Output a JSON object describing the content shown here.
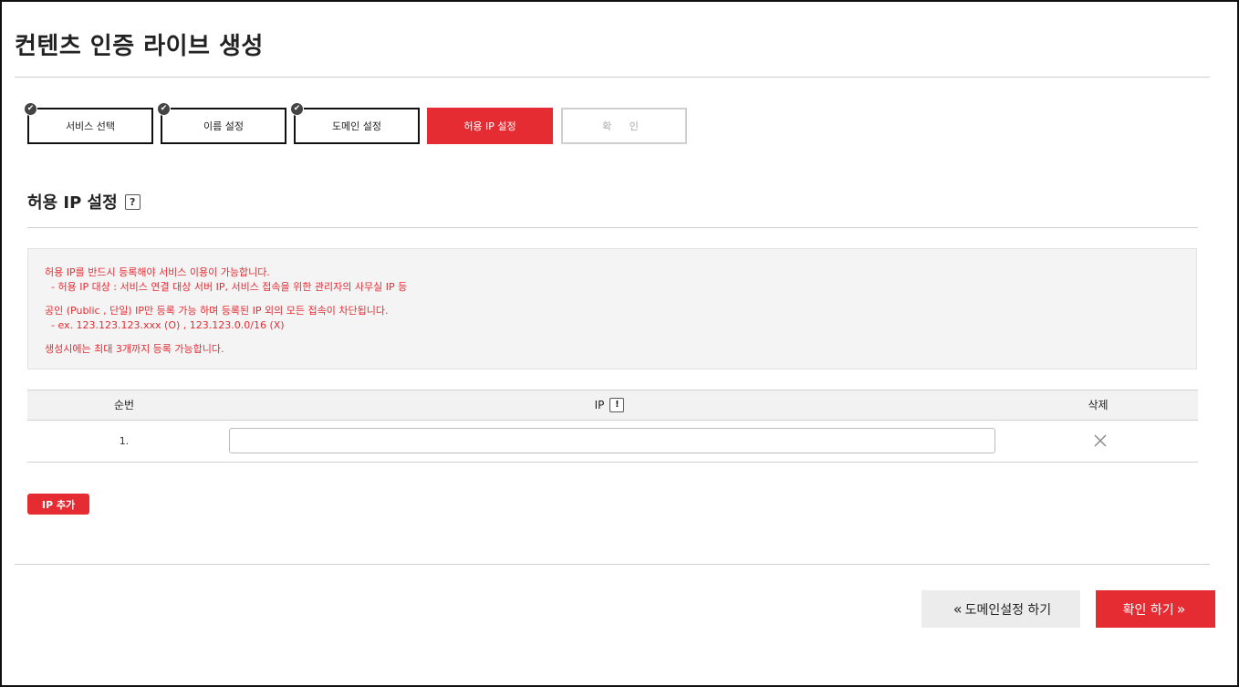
{
  "page": {
    "title": "컨텐츠 인증 라이브 생성"
  },
  "steps": [
    {
      "label": "서비스 선택",
      "status": "done"
    },
    {
      "label": "이름 설정",
      "status": "done"
    },
    {
      "label": "도메인 설정",
      "status": "done"
    },
    {
      "label": "허용 IP 설정",
      "status": "active"
    },
    {
      "label": "확 인",
      "status": "pending"
    }
  ],
  "section": {
    "title": "허용 IP 설정",
    "help_icon": "?"
  },
  "notice": {
    "line1": "허용 IP를 반드시 등록해야 서비스 이용이 가능합니다.",
    "line2": "  - 허용 IP 대상 : 서비스 연결 대상 서버 IP, 서비스 접속을 위한 관리자의 사무실 IP 등",
    "line3": "공인 (Public , 단일) IP만 등록 가능 하며 등록된 IP 외의 모든 접속이 차단됩니다.",
    "line4": "  - ex. 123.123.123.xxx (O) , 123.123.0.0/16 (X)",
    "line5": "생성시에는 최대 3개까지 등록 가능합니다."
  },
  "table": {
    "headers": {
      "num": "순번",
      "ip": "IP",
      "ip_info_icon": "!",
      "delete": "삭제"
    },
    "rows": [
      {
        "num": "1.",
        "ip": ""
      }
    ]
  },
  "buttons": {
    "add_ip": "IP 추가",
    "prev": "도메인설정 하기",
    "next": "확인 하기"
  },
  "colors": {
    "accent": "#e52c33",
    "notice_bg": "#f4f4f4"
  }
}
